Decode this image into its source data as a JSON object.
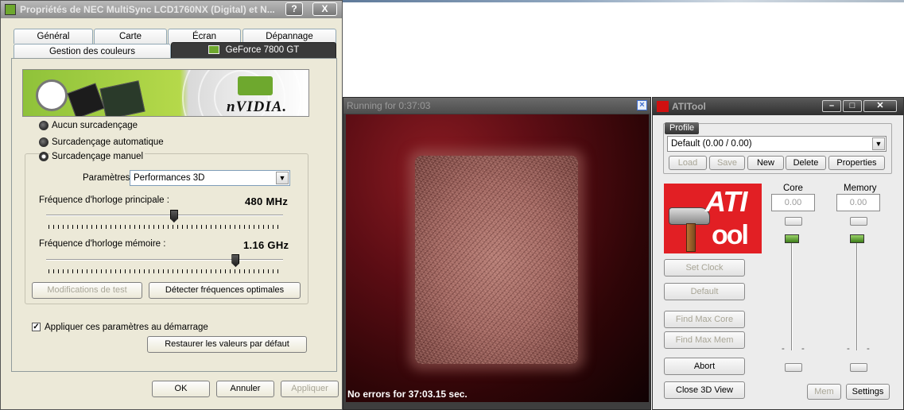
{
  "nvidia_window": {
    "title": "Propriétés de NEC MultiSync LCD1760NX (Digital) et N...",
    "help_label": "?",
    "close_label": "X",
    "tabs_row1": [
      "Général",
      "Carte",
      "Écran",
      "Dépannage"
    ],
    "tabs_row2": [
      "Gestion des couleurs",
      "GeForce 7800 GT"
    ],
    "banner_logo": "nVIDIA.",
    "radio_options": [
      "Aucun surcadençage",
      "Surcadençage automatique",
      "Surcadençage manuel"
    ],
    "selected_radio": "Surcadençage manuel",
    "params_label": "Paramètres",
    "params_value": "Performances 3D",
    "core_clock_label": "Fréquence d'horloge principale :",
    "core_clock_value": "480 MHz",
    "core_slider_fraction": 0.54,
    "memory_clock_label": "Fréquence d'horloge mémoire :",
    "memory_clock_value": "1.16 GHz",
    "memory_slider_fraction": 0.8,
    "test_button": "Modifications de test",
    "detect_button": "Détecter fréquences optimales",
    "apply_startup_label": "Appliquer ces paramètres au démarrage",
    "apply_startup_checked": true,
    "restore_button": "Restaurer les valeurs par défaut",
    "ok_button": "OK",
    "cancel_button": "Annuler",
    "apply_button": "Appliquer"
  },
  "render_window": {
    "title": "Running for 0:37:03",
    "status": "No errors for 37:03.15 sec."
  },
  "ati_window": {
    "title": "ATITool",
    "profile_label": "Profile",
    "profile_value": "Default (0.00 / 0.00)",
    "profile_buttons": [
      "Load",
      "Save",
      "New",
      "Delete",
      "Properties"
    ],
    "logo_text_top": "ATI",
    "logo_text_bottom": "ool",
    "core_label": "Core",
    "core_value": "0.00",
    "memory_label": "Memory",
    "memory_value": "0.00",
    "set_clock": "Set Clock",
    "default": "Default",
    "find_max_core": "Find Max Core",
    "find_max_mem": "Find Max Mem",
    "abort": "Abort",
    "close_3d": "Close 3D View",
    "mem": "Mem",
    "settings": "Settings"
  }
}
